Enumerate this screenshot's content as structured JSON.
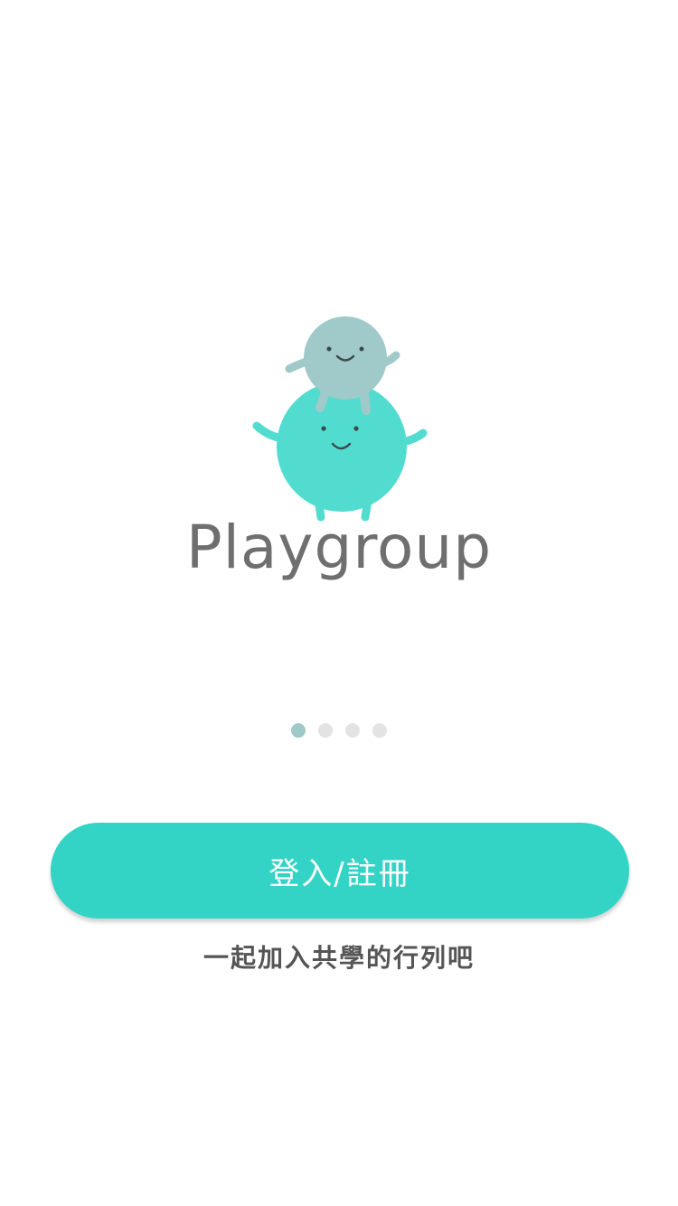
{
  "brand": {
    "name": "Playgroup",
    "colors": {
      "big_character": "#52dccf",
      "small_character": "#9fcac9",
      "text": "#6f6f6f"
    }
  },
  "pager": {
    "total": 4,
    "active_index": 0,
    "active_color": "#9ec9c8",
    "inactive_color": "#e3e3e3"
  },
  "cta": {
    "label": "登入/註冊",
    "color": "#33d4c5"
  },
  "tagline": "一起加入共學的行列吧"
}
